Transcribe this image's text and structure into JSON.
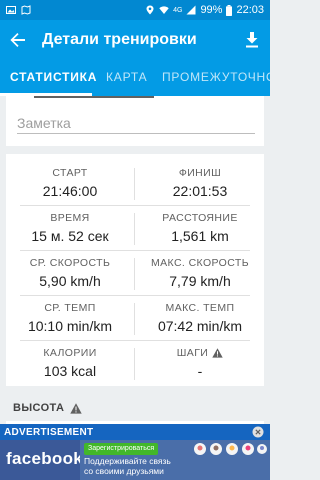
{
  "status_bar": {
    "network": "4G",
    "battery": "99%",
    "time": "22:03"
  },
  "app_bar": {
    "title": "Детали тренировки"
  },
  "tabs": [
    {
      "label": "СТАТИСТИКА",
      "active": true
    },
    {
      "label": "КАРТА",
      "active": false
    },
    {
      "label": "ПРОМЕЖУТОЧНОЕ",
      "active": false
    }
  ],
  "note": {
    "placeholder": "Заметка",
    "value": ""
  },
  "stats": {
    "start": {
      "label": "СТАРТ",
      "value": "21:46:00"
    },
    "finish": {
      "label": "ФИНИШ",
      "value": "22:01:53"
    },
    "time": {
      "label": "ВРЕМЯ",
      "value": "15 м. 52 сек"
    },
    "distance": {
      "label": "РАССТОЯНИЕ",
      "value": "1,561 km"
    },
    "avg_speed": {
      "label": "СР. СКОРОСТЬ",
      "value": "5,90 km/h"
    },
    "max_speed": {
      "label": "МАКС. СКОРОСТЬ",
      "value": "7,79 km/h"
    },
    "avg_pace": {
      "label": "СР. ТЕМП",
      "value": "10:10 min/km"
    },
    "max_pace": {
      "label": "МАКС. ТЕМП",
      "value": "07:42 min/km"
    },
    "calories": {
      "label": "КАЛОРИИ",
      "value": "103 kcal"
    },
    "steps": {
      "label": "ШАГИ",
      "value": "-"
    }
  },
  "altitude_section": {
    "title": "ВЫСОТА"
  },
  "ad": {
    "label": "ADVERTISEMENT",
    "brand": "facebook",
    "cta": "Зарегистрироваться",
    "text_line1": "Поддерживайте связь",
    "text_line2": "со своими друзьями"
  },
  "colors": {
    "primary": "#039be5",
    "status_bar": "#0288d1",
    "facebook": "#3b5998"
  }
}
